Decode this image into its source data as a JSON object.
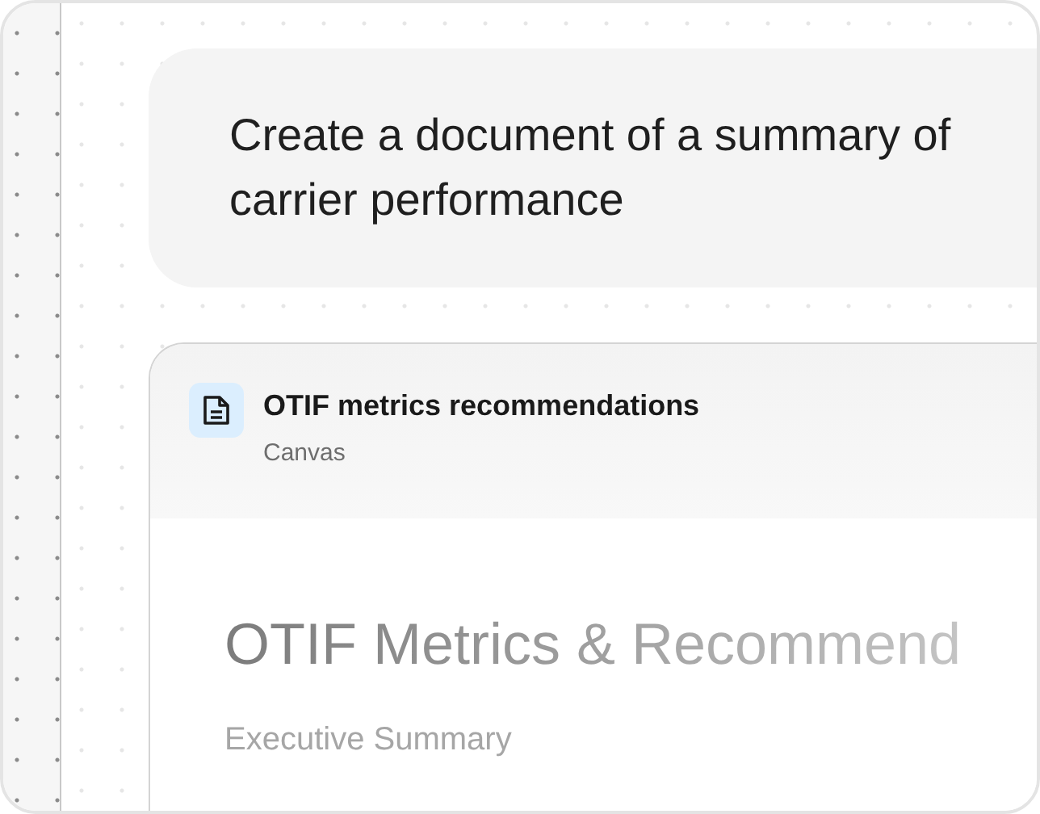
{
  "prompt": {
    "text": "Create a document of a summary of carrier performance"
  },
  "canvas_card": {
    "title": "OTIF metrics recommendations",
    "subtitle": "Canvas"
  },
  "document": {
    "title": "OTIF Metrics & Recommend",
    "section_heading": "Executive Summary"
  }
}
